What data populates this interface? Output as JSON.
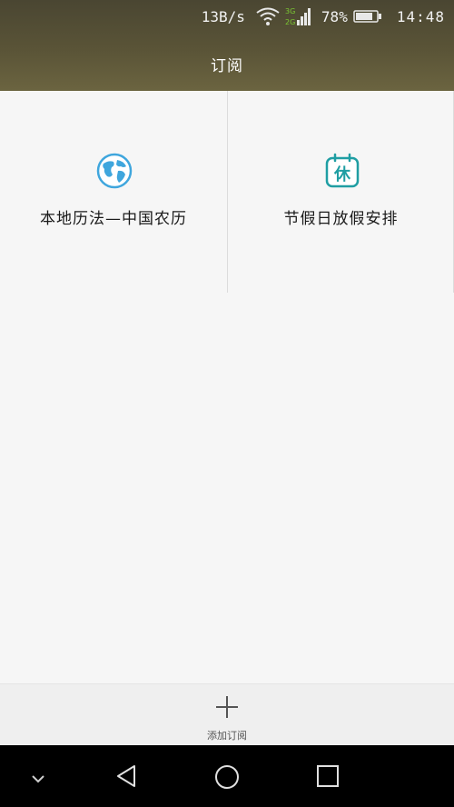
{
  "status_bar": {
    "net_speed": "13B/s",
    "network_badge_top": "3G",
    "network_badge_bottom": "2G",
    "battery": "78%",
    "time": "14:48"
  },
  "header": {
    "title": "订阅"
  },
  "subscriptions": [
    {
      "label": "本地历法—中国农历",
      "icon": "globe-icon"
    },
    {
      "label": "节假日放假安排",
      "icon": "holiday-calendar-icon",
      "icon_text": "休"
    }
  ],
  "bottom_action": {
    "label": "添加订阅",
    "icon": "plus-icon"
  },
  "colors": {
    "accent_blue": "#3fa6dd",
    "accent_teal": "#1f9ea3",
    "network_green": "#7bc832"
  }
}
